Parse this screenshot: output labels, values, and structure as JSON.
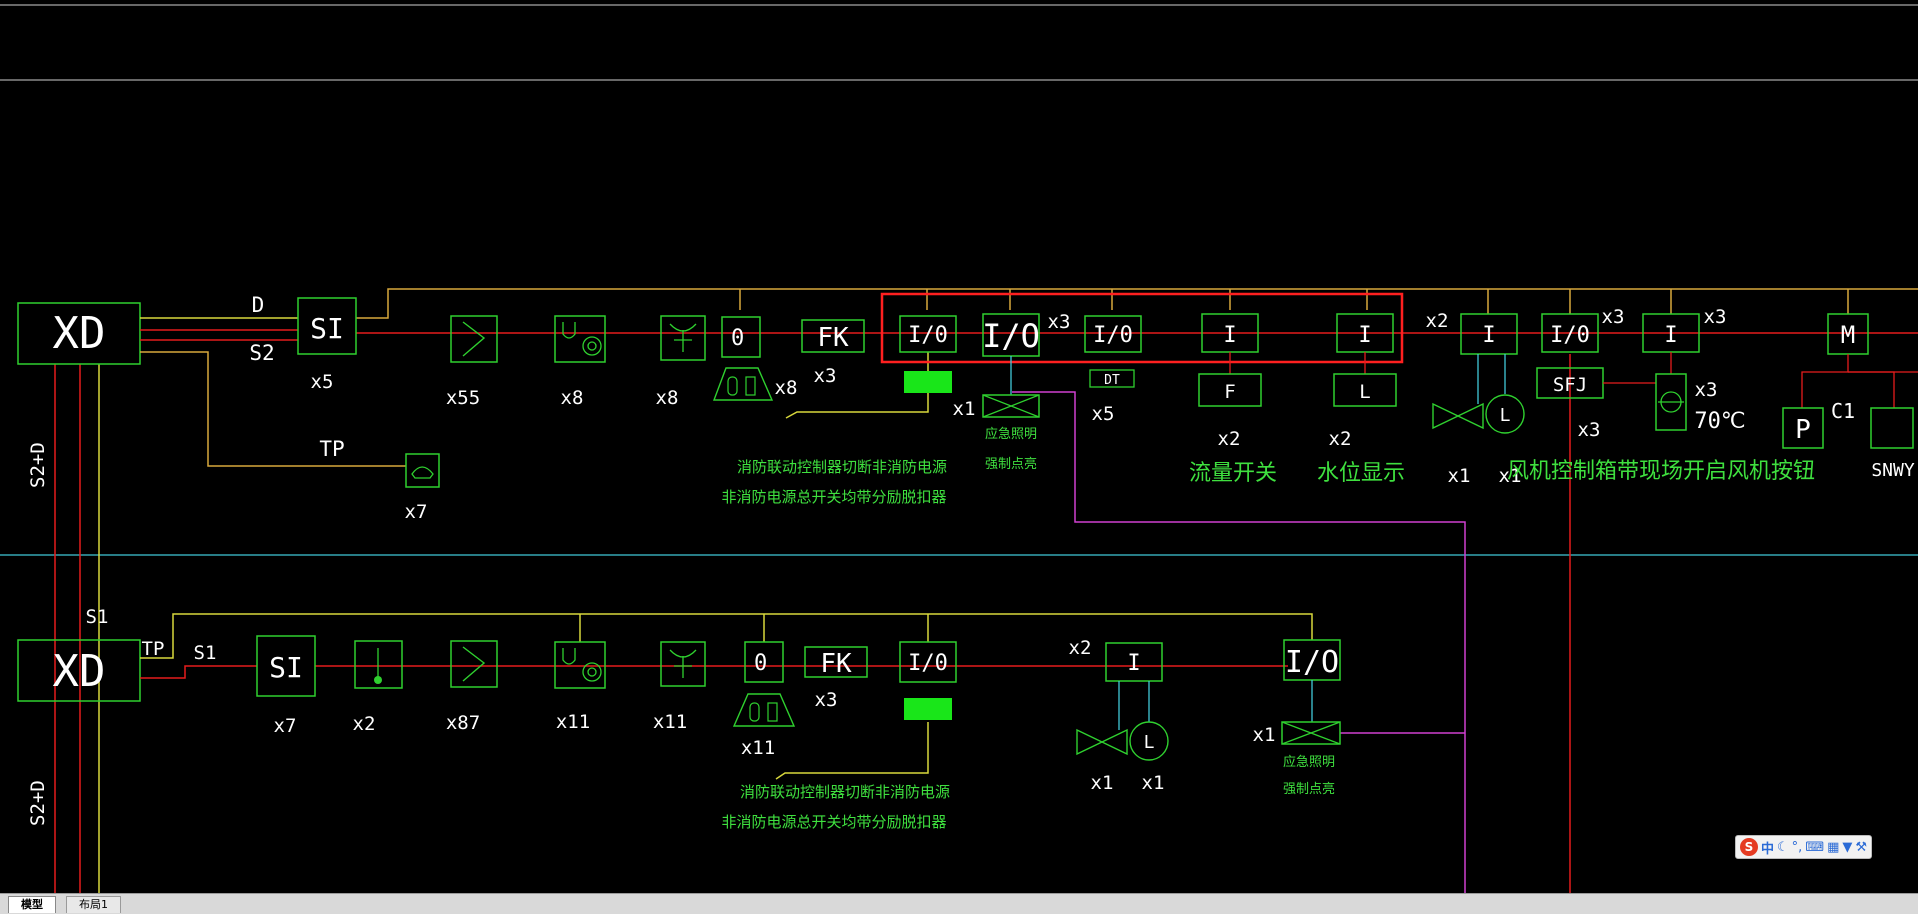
{
  "tabs": {
    "model": "模型",
    "layout1": "布局1"
  },
  "ime": {
    "logo": "S",
    "mode": "中",
    "icons": [
      "moon-icon",
      "punct-icon",
      "keyboard-icon",
      "toolbox-icon",
      "shirt-icon",
      "wrench-icon"
    ]
  },
  "colors": {
    "background": "#000000",
    "bus_red": "#e51c1c",
    "bus_yellow": "#d8d83c",
    "bus_orange": "#d8a83c",
    "device_green": "#2fd02f",
    "label_white": "#ffffff",
    "note_green": "#3fe03f",
    "link_magenta": "#d040d0",
    "divider_cyan": "#40c8d8",
    "highlight_red": "#ff2020"
  },
  "labels": {
    "xd_top": "XD",
    "xd_bottom": "XD",
    "riser_top": "S2+D",
    "riser_bottom": "S2+D",
    "d": "D",
    "s2": "S2",
    "tp_top": "TP",
    "tp_bottom": "TP",
    "s1_riser": "S1",
    "s1_bottom": "S1"
  },
  "top_row": {
    "si": {
      "text": "SI",
      "count": "x5"
    },
    "detector": {
      "count": "x55"
    },
    "horn": {
      "count": "x8"
    },
    "hydrant": {
      "count": "x8"
    },
    "zero": {
      "text": "0"
    },
    "alarm_valve": {
      "count": "x8"
    },
    "fk": {
      "text": "FK",
      "count": "x3"
    },
    "io1": {
      "text": "I/0"
    },
    "io_big": {
      "text": "I/O",
      "count_right": "x3"
    },
    "io_dt": {
      "text": "I/0",
      "sub": "DT",
      "count": "x5"
    },
    "input_f": {
      "text": "I",
      "sub": "F",
      "count": "x2",
      "caption": "流量开关"
    },
    "input_l": {
      "text": "I",
      "sub": "L",
      "count": "x2",
      "caption": "水位显示"
    },
    "x2_left": "x2",
    "pump_input": {
      "text": "I",
      "count_valve": "x1",
      "count_level": "x1",
      "level_letter": "L"
    },
    "io_sfj": {
      "text": "I/0",
      "sub": "SFJ",
      "count_right": "x3",
      "count_below": "x3"
    },
    "input_70": {
      "text": "I",
      "count_right": "x3",
      "sub_count": "x3",
      "temp": "70℃"
    },
    "fan_caption": "风机控制箱带现场开启风机按钮",
    "m": {
      "text": "M"
    },
    "p": {
      "text": "P"
    },
    "c1": "C1",
    "snwy": "SNWY",
    "emergency": {
      "count": "x1",
      "line1": "应急照明",
      "line2": "强制点亮"
    },
    "note_line1": "消防联动控制器切断非消防电源",
    "note_line2": "非消防电源总开关均带分励脱扣器",
    "phone": {
      "count": "x7"
    }
  },
  "bottom_row": {
    "si": {
      "text": "SI",
      "count": "x7"
    },
    "manual": {
      "count": "x2"
    },
    "detector": {
      "count": "x87"
    },
    "horn": {
      "count": "x11"
    },
    "hydrant": {
      "count": "x11"
    },
    "zero": {
      "text": "0"
    },
    "alarm_valve": {
      "count": "x11"
    },
    "fk": {
      "text": "FK",
      "count": "x3"
    },
    "io1": {
      "text": "I/0"
    },
    "x2_label": "x2",
    "pump_input": {
      "text": "I",
      "count_valve": "x1",
      "count_level": "x1",
      "level_letter": "L"
    },
    "io_big": {
      "text": "I/O"
    },
    "emergency": {
      "count": "x1",
      "line1": "应急照明",
      "line2": "强制点亮"
    },
    "note_line1": "消防联动控制器切断非消防电源",
    "note_line2": "非消防电源总开关均带分励脱扣器"
  }
}
